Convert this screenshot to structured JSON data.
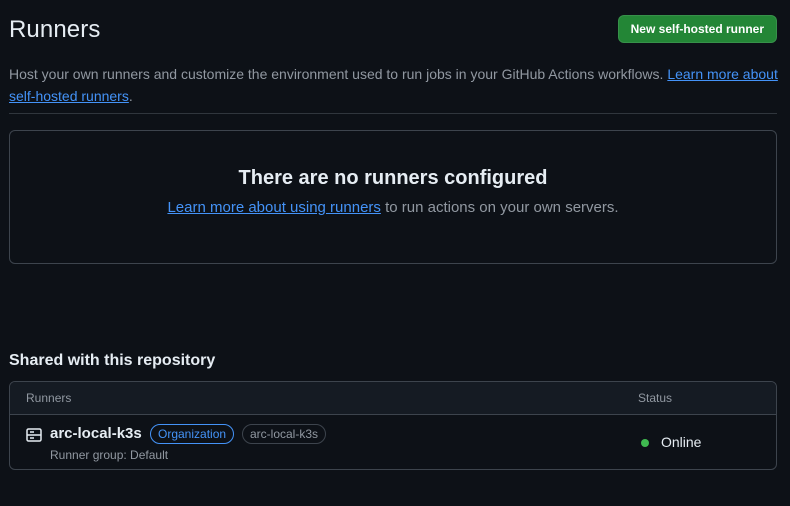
{
  "header": {
    "title": "Runners",
    "new_runner_label": "New self-hosted runner"
  },
  "description": {
    "text": "Host your own runners and customize the environment used to run jobs in your GitHub Actions workflows. ",
    "link_text": "Learn more about self-hosted runners",
    "suffix": "."
  },
  "empty_state": {
    "title": "There are no runners configured",
    "link_text": "Learn more about using runners",
    "text": " to run actions on your own servers."
  },
  "shared": {
    "title": "Shared with this repository",
    "columns": {
      "runners": "Runners",
      "status": "Status"
    },
    "rows": [
      {
        "name": "arc-local-k3s",
        "icon": "server-icon",
        "labels": [
          "Organization",
          "arc-local-k3s"
        ],
        "group": "Runner group: Default",
        "status": "Online",
        "status_color": "#3fb950"
      }
    ]
  },
  "colors": {
    "background": "#0d1117",
    "accent": "#4493f8",
    "primary_button": "#238636"
  }
}
